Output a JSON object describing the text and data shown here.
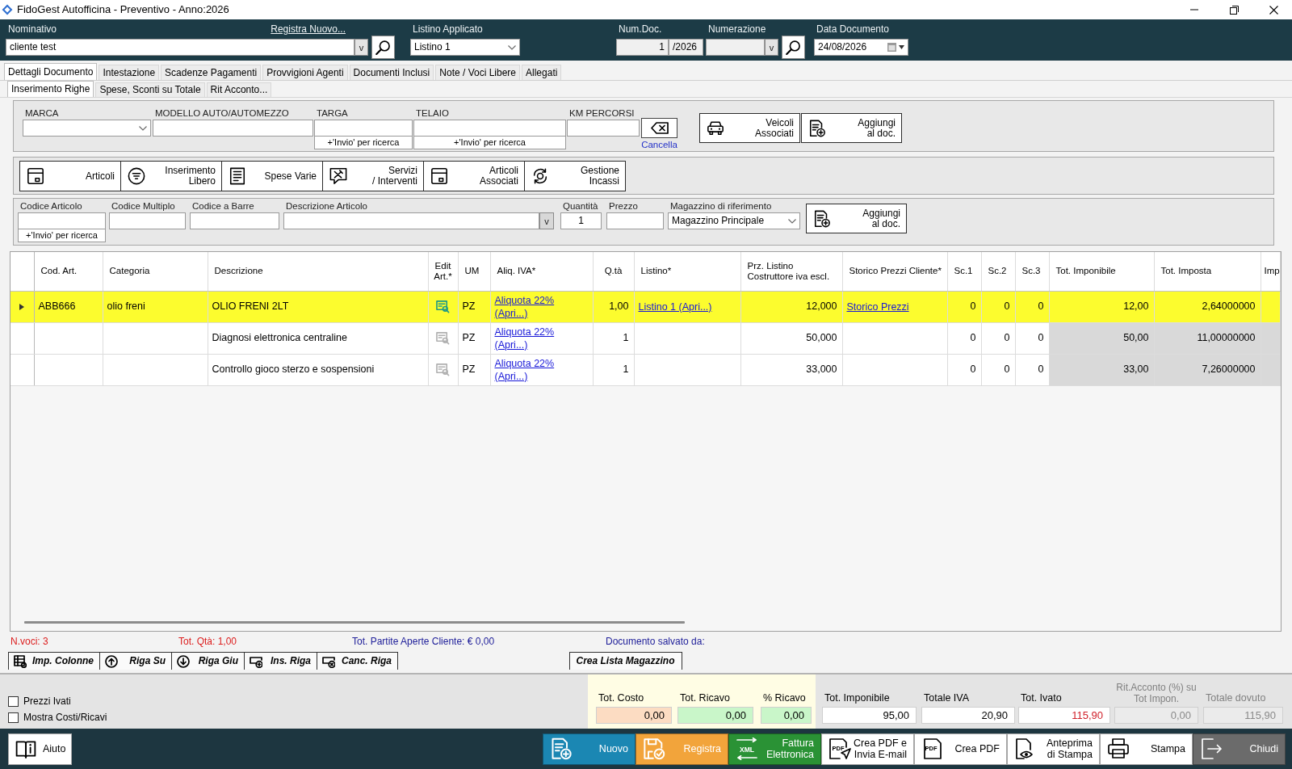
{
  "window": {
    "title": "FidoGest Autofficina - Preventivo - Anno:2026"
  },
  "header": {
    "customer": {
      "label": "Nominativo",
      "value": "cliente test",
      "register_link": "Registra Nuovo...",
      "dropdown_button": "v"
    },
    "price_list": {
      "label": "Listino Applicato",
      "value": "Listino 1"
    },
    "doc_number": {
      "label": "Num.Doc.",
      "value": "1",
      "year": "/2026"
    },
    "numbering": {
      "label": "Numerazione",
      "dropdown_button": "v"
    },
    "doc_date": {
      "label": "Data Documento",
      "value": "24/08/2026"
    }
  },
  "tabs": [
    {
      "label": "Dettagli Documento",
      "selected": true
    },
    {
      "label": "Intestazione",
      "selected": false
    },
    {
      "label": "Scadenze Pagamenti",
      "selected": false
    },
    {
      "label": "Provvigioni Agenti",
      "selected": false
    },
    {
      "label": "Documenti Inclusi",
      "selected": false
    },
    {
      "label": "Note / Voci Libere",
      "selected": false
    },
    {
      "label": "Allegati",
      "selected": false
    }
  ],
  "subtabs": [
    {
      "label": "Inserimento Righe",
      "selected": true
    },
    {
      "label": "Spese, Sconti su Totale",
      "selected": false
    },
    {
      "label": "Rit Acconto...",
      "selected": false
    }
  ],
  "vehicle": {
    "fields": [
      {
        "label": "MARCA",
        "kind": "dropdown"
      },
      {
        "label": "MODELLO AUTO/AUTOMEZZO",
        "kind": "text"
      },
      {
        "label": "TARGA",
        "kind": "search",
        "hint": "+'Invio' per ricerca"
      },
      {
        "label": "TELAIO",
        "kind": "search",
        "hint": "+'Invio' per ricerca"
      },
      {
        "label": "KM PERCORSI",
        "kind": "text"
      }
    ],
    "clear_label": "Cancella",
    "buttons": [
      "Veicoli\nAssociati",
      "Aggiungi\nal doc."
    ]
  },
  "toolbar": [
    "Articoli",
    "Inserimento\nLibero",
    "Spese Varie",
    "Servizi\n/ Interventi",
    "Articoli\nAssociati",
    "Gestione\nIncassi"
  ],
  "article_entry": {
    "fields": [
      {
        "label": "Codice Articolo",
        "kind": "search",
        "hint": "+'Invio' per ricerca"
      },
      {
        "label": "Codice Multiplo",
        "kind": "text"
      },
      {
        "label": "Codice a Barre",
        "kind": "text"
      },
      {
        "label": "Descrizione Articolo",
        "kind": "combo",
        "dropdown_button": "v"
      },
      {
        "label": "Quantità",
        "kind": "number",
        "value": "1"
      },
      {
        "label": "Prezzo",
        "kind": "text"
      },
      {
        "label": "Magazzino di riferimento",
        "kind": "dropdown",
        "value": "Magazzino Principale"
      }
    ],
    "add_button": "Aggiungi\nal doc."
  },
  "table": {
    "columns": [
      {
        "label": "Cod. Art.",
        "read_only": false
      },
      {
        "label": "Categoria",
        "read_only": false
      },
      {
        "label": "Descrizione",
        "read_only": false
      },
      {
        "label": "Edit Art.*",
        "read_only": false
      },
      {
        "label": "UM",
        "read_only": false
      },
      {
        "label": "Aliq. IVA*",
        "read_only": false
      },
      {
        "label": "Q.tà",
        "read_only": false
      },
      {
        "label": "Listino*",
        "read_only": false
      },
      {
        "label": "Prz. Listino Costruttore iva escl.",
        "read_only": false
      },
      {
        "label": "Storico Prezzi Cliente*",
        "read_only": false
      },
      {
        "label": "Sc.1",
        "read_only": false
      },
      {
        "label": "Sc.2",
        "read_only": false
      },
      {
        "label": "Sc.3",
        "read_only": false
      },
      {
        "label": "Tot. Imponibile",
        "read_only": true
      },
      {
        "label": "Tot. Imposta",
        "read_only": true
      },
      {
        "label": "Imp",
        "read_only": true
      }
    ],
    "rows": [
      {
        "selected": true,
        "cells": [
          {
            "kind": "text",
            "text": "ABB666"
          },
          {
            "kind": "text",
            "text": "olio freni"
          },
          {
            "kind": "text",
            "text": "OLIO FRENI 2LT"
          },
          {
            "kind": "edit",
            "enabled": true
          },
          {
            "kind": "text",
            "text": "PZ"
          },
          {
            "kind": "link",
            "text": "Aliquota 22% (Apri...)"
          },
          {
            "kind": "number",
            "text": "1,00"
          },
          {
            "kind": "link",
            "text": "Listino 1 (Apri...)"
          },
          {
            "kind": "number",
            "text": "12,000"
          },
          {
            "kind": "link",
            "text": "Storico Prezzi"
          },
          {
            "kind": "number",
            "text": "0"
          },
          {
            "kind": "number",
            "text": "0"
          },
          {
            "kind": "number",
            "text": "0"
          },
          {
            "kind": "number",
            "text": "12,00"
          },
          {
            "kind": "number",
            "text": "2,64000000"
          },
          {
            "kind": "text"
          }
        ]
      },
      {
        "selected": false,
        "cells": [
          {
            "kind": "text"
          },
          {
            "kind": "text"
          },
          {
            "kind": "text",
            "text": "Diagnosi elettronica centraline"
          },
          {
            "kind": "edit",
            "enabled": false
          },
          {
            "kind": "text",
            "text": "PZ"
          },
          {
            "kind": "link",
            "text": "Aliquota 22% (Apri...)"
          },
          {
            "kind": "number",
            "text": "1"
          },
          {
            "kind": "text"
          },
          {
            "kind": "number",
            "text": "50,000"
          },
          {
            "kind": "text"
          },
          {
            "kind": "number",
            "text": "0"
          },
          {
            "kind": "number",
            "text": "0"
          },
          {
            "kind": "number",
            "text": "0"
          },
          {
            "kind": "number",
            "text": "50,00"
          },
          {
            "kind": "number",
            "text": "11,00000000"
          },
          {
            "kind": "text"
          }
        ]
      },
      {
        "selected": false,
        "cells": [
          {
            "kind": "text"
          },
          {
            "kind": "text"
          },
          {
            "kind": "text",
            "text": "Controllo gioco sterzo e sospensioni"
          },
          {
            "kind": "edit",
            "enabled": false
          },
          {
            "kind": "text",
            "text": "PZ"
          },
          {
            "kind": "link",
            "text": "Aliquota 22% (Apri...)"
          },
          {
            "kind": "number",
            "text": "1"
          },
          {
            "kind": "text"
          },
          {
            "kind": "number",
            "text": "33,000"
          },
          {
            "kind": "text"
          },
          {
            "kind": "number",
            "text": "0"
          },
          {
            "kind": "number",
            "text": "0"
          },
          {
            "kind": "number",
            "text": "0"
          },
          {
            "kind": "number",
            "text": "33,00"
          },
          {
            "kind": "number",
            "text": "7,26000000"
          },
          {
            "kind": "text"
          }
        ]
      }
    ]
  },
  "status": {
    "item_count": "N.voci: 3",
    "total_quantity": "Tot. Qtà: 1,00",
    "open_items": "Tot. Partite Aperte Cliente: € 0,00",
    "saved_by": "Documento salvato da:"
  },
  "row_actions": [
    "Imp. Colonne",
    "Riga Su",
    "Riga Giu",
    "Ins. Riga",
    "Canc. Riga"
  ],
  "warehouse_list_button": "Crea Lista Magazzino",
  "options": [
    {
      "label": "Prezzi Ivati",
      "checked": false
    },
    {
      "label": "Mostra Costi/Ricavi",
      "checked": false
    }
  ],
  "margins": [
    {
      "label": "Tot. Costo",
      "value": "0,00",
      "color": "#fcdcc2"
    },
    {
      "label": "Tot. Ricavo",
      "value": "0,00",
      "color": "#c9f6c9"
    },
    {
      "label": "% Ricavo",
      "value": "0,00",
      "color": "#c9f6c9"
    }
  ],
  "totals": [
    {
      "label": "Tot. Imponibile",
      "value": "95,00",
      "disabled": false,
      "highlighted": false
    },
    {
      "label": "Totale IVA",
      "value": "20,90",
      "disabled": false,
      "highlighted": false
    },
    {
      "label": "Tot. Ivato",
      "value": "115,90",
      "disabled": false,
      "highlighted": true
    },
    {
      "label": "Rit.Acconto (%) su Tot Impon.",
      "value": "0,00",
      "disabled": true,
      "highlighted": false
    },
    {
      "label": "Totale dovuto",
      "value": "115,90",
      "disabled": true,
      "highlighted": false
    }
  ],
  "footer_buttons": [
    {
      "label": "Aiuto",
      "color": "#ffffff"
    },
    {
      "label": "Nuovo",
      "color": "#1b87b3"
    },
    {
      "label": "Registra",
      "color": "#f2a43b"
    },
    {
      "label": "Fattura\nElettronica",
      "color": "#2a9235",
      "icon_text": "XML"
    },
    {
      "label": "Crea PDF e\nInvia E-mail",
      "color": "#ffffff",
      "icon_text": "PDF"
    },
    {
      "label": "Crea PDF",
      "color": "#ffffff",
      "icon_text": "PDF"
    },
    {
      "label": "Anteprima\ndi Stampa",
      "color": "#ffffff"
    },
    {
      "label": "Stampa",
      "color": "#ffffff"
    },
    {
      "label": "Chiudi",
      "color": "#6b6b6b"
    }
  ]
}
